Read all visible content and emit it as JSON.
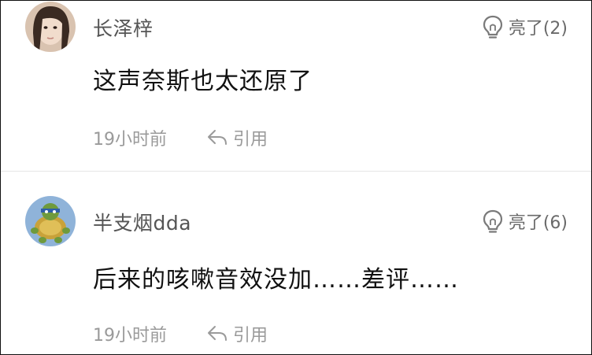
{
  "comments": [
    {
      "username": "长泽梓",
      "like_label": "亮了(2)",
      "text": "这声奈斯也太还原了",
      "time": "19小时前",
      "quote_label": "引用",
      "avatar_icon": "user-photo-avatar"
    },
    {
      "username": "半支烟dda",
      "like_label": "亮了(6)",
      "text": "后来的咳嗽音效没加……差评……",
      "time": "19小时前",
      "quote_label": "引用",
      "avatar_icon": "turtle-avatar"
    }
  ],
  "colors": {
    "username": "#555555",
    "meta": "#9a9a9a",
    "body": "#111111",
    "divider": "#e6e6e6"
  }
}
